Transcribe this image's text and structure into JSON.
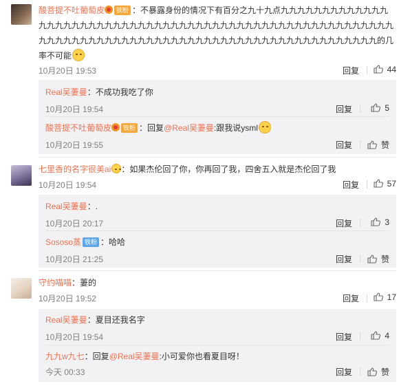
{
  "comments": [
    {
      "user": "酸菩提不吐葡萄皮",
      "badge": "铁粉",
      "text": "：不暴露身份的情况下有百分之九十九点九九九九九九九九九九九九九九九九九九九九九九九九九九九九九九九九九九九九九九九九九九九九九九九九九九九九九九九九九九九九九九九九九九九九九九九九九九九九九九九九九九九九九九九九九九九九九九九九九的几率不可能",
      "time": "10月20日 19:53",
      "reply": "回复",
      "likes": "44",
      "replies": [
        {
          "user": "Real吴萋曼",
          "text": "：不成功我吃了你",
          "time": "10月20日 19:54",
          "reply": "回复",
          "likes": "5"
        },
        {
          "user": "酸菩提不吐葡萄皮",
          "badge": "铁粉",
          "prefix": "：回复",
          "at": "@Real吴萋曼",
          "text": ":跟我说ysml",
          "time": "10月20日 19:55",
          "reply": "回复",
          "likes": "赞"
        }
      ]
    },
    {
      "user": "七里香的名字很美ai",
      "text": "：如果杰伦回了你，你再回了我，四舍五入就是杰伦回了我",
      "time": "10月20日 19:54",
      "reply": "回复",
      "likes": "57",
      "replies": [
        {
          "user": "Real吴萋曼",
          "text": "：.",
          "time": "10月20日 20:17",
          "reply": "回复",
          "likes": "3"
        },
        {
          "user": "Sososo蒸",
          "badge": "铁粉",
          "text": "：哈哈",
          "time": "10月20日 21:25",
          "reply": "回复",
          "likes": "赞"
        }
      ]
    },
    {
      "user": "守约喵喵",
      "text": "：萋的",
      "time": "10月20日 19:52",
      "reply": "回复",
      "likes": "17",
      "replies": [
        {
          "user": "Real吴萋曼",
          "text": "：夏目还我名字",
          "time": "10月20日 19:54",
          "reply": "回复",
          "likes": "4"
        },
        {
          "user": "九九w九七",
          "prefix": "：回复",
          "at": "@Real吴萋曼",
          "text": ":小可爱你也看夏目呀！",
          "time": "今天 00:33",
          "reply": "回复",
          "likes": "赞"
        }
      ]
    }
  ],
  "colors": {
    "username": "#eb7350",
    "meta": "#808080",
    "subBg": "#f2f2f5"
  }
}
